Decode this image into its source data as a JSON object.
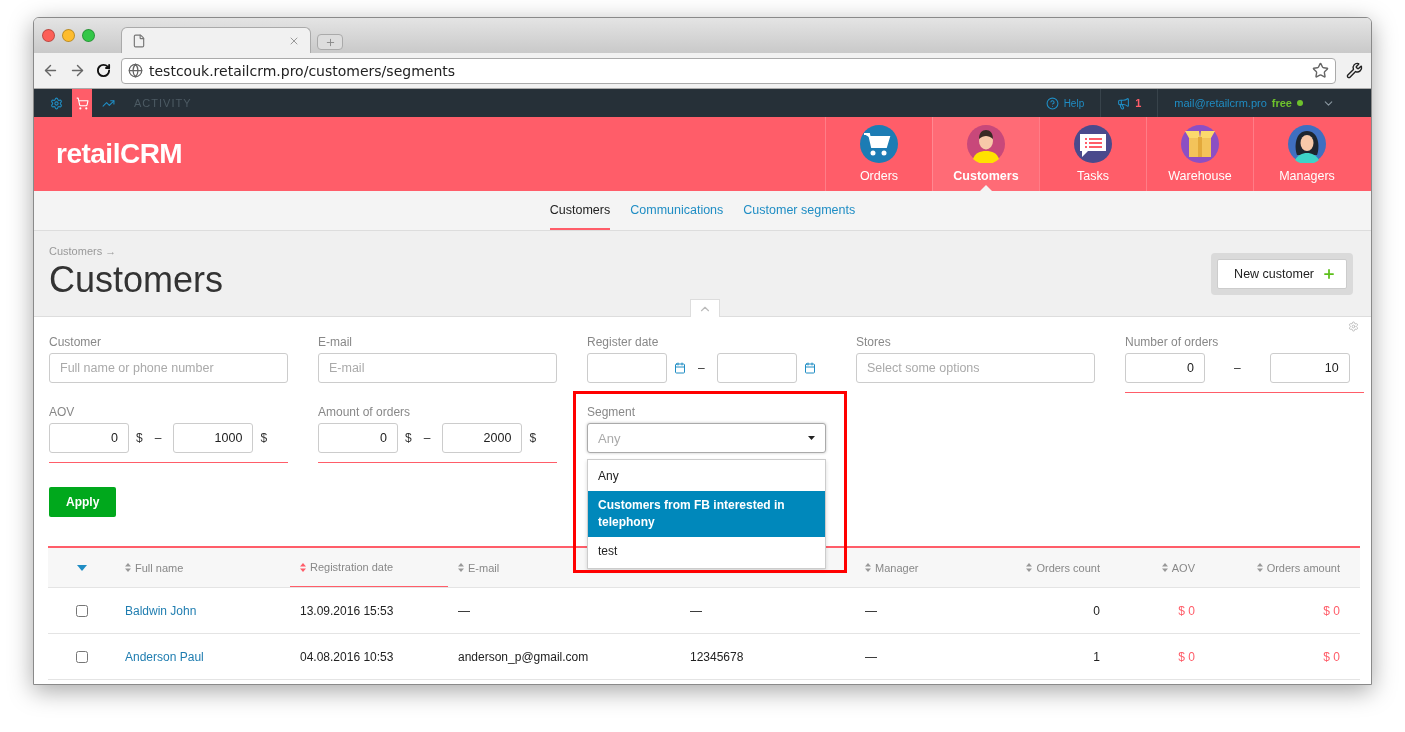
{
  "browser": {
    "url": "testcouk.retailcrm.pro/customers/segments"
  },
  "topbar": {
    "tools": [
      {
        "kind": "settings",
        "selected": false
      },
      {
        "kind": "cart",
        "selected": true
      },
      {
        "kind": "chart",
        "selected": false
      }
    ],
    "activity": "ACTIVITY",
    "help": "Help",
    "notifications": "1",
    "account": "mail@retailcrm.pro",
    "plan": "free",
    "online": true
  },
  "header": {
    "logo": "retailCRM",
    "nav": [
      {
        "label": "Orders",
        "kind": "orders",
        "selected": false
      },
      {
        "label": "Customers",
        "kind": "customers",
        "selected": true
      },
      {
        "label": "Tasks",
        "kind": "tasks",
        "selected": false
      },
      {
        "label": "Warehouse",
        "kind": "warehouse",
        "selected": false
      },
      {
        "label": "Managers",
        "kind": "managers",
        "selected": false
      }
    ]
  },
  "subnav": [
    {
      "label": "Customers",
      "selected": true
    },
    {
      "label": "Communications",
      "selected": false
    },
    {
      "label": "Customer segments",
      "selected": false
    }
  ],
  "page": {
    "breadcrumb": "Customers →",
    "title": "Customers",
    "new_button": "New customer"
  },
  "filters": [
    {
      "kind": "text",
      "label": "Customer",
      "placeholder": "Full name or phone number"
    },
    {
      "kind": "text",
      "label": "E-mail",
      "placeholder": "E-mail"
    },
    {
      "kind": "date_range",
      "label": "Register date",
      "separator": "–"
    },
    {
      "kind": "text",
      "label": "Stores",
      "placeholder": "Select some options"
    },
    {
      "kind": "range",
      "label": "Number of orders",
      "from": "0",
      "to": "10",
      "separator": "–"
    },
    {
      "kind": "range",
      "label": "AOV",
      "from": "0",
      "to": "1000",
      "unit": "$",
      "separator": "–"
    },
    {
      "kind": "range",
      "label": "Amount of orders",
      "from": "0",
      "to": "2000",
      "unit": "$",
      "separator": "–"
    },
    {
      "kind": "select",
      "label": "Segment",
      "placeholder": "Any",
      "expanded": true,
      "options": [
        {
          "label": "Any",
          "selected": false
        },
        {
          "label": "Customers from FB interested in telephony",
          "selected": true
        },
        {
          "label": "test",
          "selected": false
        }
      ]
    }
  ],
  "apply": "Apply",
  "table": {
    "columns": [
      {
        "label": "Full name",
        "kind": "link",
        "sorted": false
      },
      {
        "label": "Registration date",
        "kind": "text",
        "sorted": true
      },
      {
        "label": "E-mail",
        "kind": "text",
        "sorted": false
      },
      {
        "kind": "text",
        "sorted": false
      },
      {
        "label": "Manager",
        "kind": "text",
        "sorted": false
      },
      {
        "label": "Orders count",
        "kind": "number",
        "sorted": false
      },
      {
        "label": "AOV",
        "kind": "money",
        "sorted": false
      },
      {
        "label": "Orders amount",
        "kind": "money",
        "sorted": false
      }
    ],
    "rows": [
      {
        "checked": false,
        "cells": [
          "Baldwin John",
          "13.09.2016 15:53",
          "—",
          "—",
          "—",
          "0",
          "$ 0",
          "$ 0"
        ]
      },
      {
        "checked": false,
        "cells": [
          "Anderson Paul",
          "04.08.2016 10:53",
          "anderson_p@gmail.com",
          "12345678",
          "—",
          "1",
          "$ 0",
          "$ 0"
        ]
      }
    ]
  }
}
